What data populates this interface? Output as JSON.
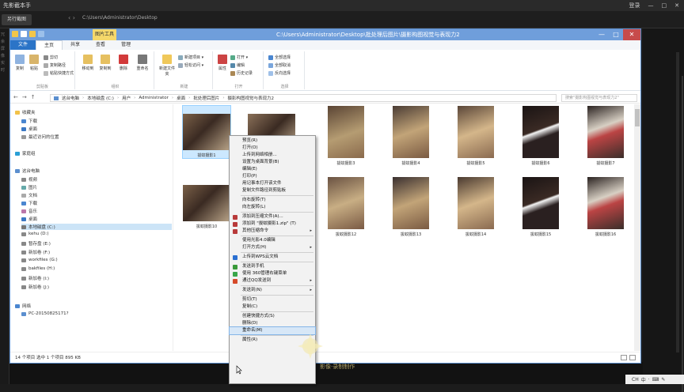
{
  "app": {
    "title": "先影截本手",
    "toolbar_button": "另行截图",
    "path": "C:\\Users\\Administrator\\Desktop",
    "controls": [
      "登录",
      "—",
      "□",
      "✕"
    ],
    "left_rail": [
      "冗",
      "余",
      "屏",
      "像",
      "实",
      "时"
    ]
  },
  "window": {
    "title": "C:\\Users\\Administrator\\Desktop\\批处理后图片\\摄影构图视觉与表现力2",
    "tool_tab": "图片工具",
    "controls": [
      "—",
      "□",
      "✕"
    ]
  },
  "ribbon": {
    "tabs": [
      "文件",
      "主页",
      "共享",
      "查看",
      "管理"
    ],
    "groups": [
      {
        "label": "剪贴板",
        "buttons": [
          "复制",
          "粘贴"
        ],
        "small": [
          "剪切",
          "复制路径",
          "粘贴快捷方式"
        ]
      },
      {
        "label": "组织",
        "buttons": [
          "移动到",
          "复制到",
          "删除",
          "重命名"
        ]
      },
      {
        "label": "新建",
        "buttons": [
          "新建文件夹"
        ],
        "small": [
          "新建项目 ▾",
          "轻松访问 ▾"
        ]
      },
      {
        "label": "打开",
        "buttons": [
          "属性"
        ],
        "small": [
          "打开 ▾",
          "编辑",
          "历史记录"
        ]
      },
      {
        "label": "选择",
        "small": [
          "全部选择",
          "全部取消",
          "反向选择"
        ]
      }
    ]
  },
  "address": {
    "crumbs": [
      "这台电脑",
      "本地磁盘 (C:)",
      "用户",
      "Administrator",
      "桌面",
      "批处理后图片",
      "摄影构图视觉与表现力2"
    ],
    "search_placeholder": "搜索\"摄影构图视觉与表现力2\""
  },
  "nav_pane": {
    "favorites": "收藏夹",
    "fav_items": [
      "下载",
      "桌面",
      "最近访问的位置"
    ],
    "homegroup": "家庭组",
    "thispc": "这台电脑",
    "pc_items": [
      "视频",
      "图片",
      "文档",
      "下载",
      "音乐",
      "桌面",
      "本地磁盘 (C:)",
      "kehu (D:)",
      "暂存盘 (E:)",
      "新加卷 (F:)",
      "workfiles (G:)",
      "bakfiles (H:)",
      "新加卷 (I:)",
      "新加卷 (J:)"
    ],
    "network": "网络",
    "network_items": [
      "PC-20150825171?"
    ]
  },
  "files": [
    "拔蚊摄影1",
    "",
    "拔蚊摄影3",
    "拔蚊摄影4",
    "拔蚊摄影5",
    "拔蚊摄影6",
    "拔蚊摄影7",
    "拔蚊摄影10",
    "",
    "拔蚊摄影12",
    "拔蚊摄影13",
    "拔蚊摄影14",
    "拔蚊摄影15",
    "拔蚊摄影16"
  ],
  "status": {
    "text": "14 个项目    选中 1 个项目  895 KB"
  },
  "context_menu": {
    "items": [
      {
        "label": "预览(R)",
        "icon": "",
        "arrow": false
      },
      {
        "label": "打开(O)",
        "icon": "",
        "arrow": false
      },
      {
        "label": "上传到网络相册...",
        "icon": "",
        "arrow": false
      },
      {
        "label": "设置为桌面背景(B)",
        "icon": "",
        "arrow": false
      },
      {
        "label": "编辑(E)",
        "icon": "",
        "arrow": false
      },
      {
        "label": "打印(P)",
        "icon": "",
        "arrow": false
      },
      {
        "label": "用记事本打开该文件",
        "icon": "",
        "arrow": false
      },
      {
        "label": "复制文件路径到剪贴板",
        "icon": "",
        "arrow": false
      },
      {
        "sep": true
      },
      {
        "label": "向右旋转(T)",
        "icon": "",
        "arrow": false
      },
      {
        "label": "向左旋转(L)",
        "icon": "",
        "arrow": false
      },
      {
        "sep": true
      },
      {
        "label": "添加到压缩文件(A)...",
        "icon": "archive",
        "arrow": false
      },
      {
        "label": "添加到 \"拔蚊摄影1.zip\" (T)",
        "icon": "archive",
        "arrow": false
      },
      {
        "label": "其他压缩命令",
        "icon": "archive",
        "arrow": true
      },
      {
        "sep": true
      },
      {
        "label": "使用光影4.0编辑",
        "icon": "",
        "arrow": false
      },
      {
        "label": "打开方式(H)",
        "icon": "",
        "arrow": true
      },
      {
        "sep": true
      },
      {
        "label": "上传到WPS云文档",
        "icon": "wps",
        "arrow": false
      },
      {
        "sep": true
      },
      {
        "label": "发送到手机",
        "icon": "phone",
        "arrow": false
      },
      {
        "label": "使用 360管理右键菜单",
        "icon": "360",
        "arrow": false
      },
      {
        "label": "通过QQ发送到",
        "icon": "qq",
        "arrow": true
      },
      {
        "sep": true
      },
      {
        "label": "发送到(N)",
        "icon": "",
        "arrow": true
      },
      {
        "sep": true
      },
      {
        "label": "剪切(T)",
        "icon": "",
        "arrow": false
      },
      {
        "label": "复制(C)",
        "icon": "",
        "arrow": false
      },
      {
        "sep": true
      },
      {
        "label": "创建快捷方式(S)",
        "icon": "",
        "arrow": false
      },
      {
        "label": "删除(D)",
        "icon": "",
        "arrow": false
      },
      {
        "label": "重命名(M)",
        "icon": "",
        "arrow": false,
        "highlight": true
      },
      {
        "sep": true
      },
      {
        "label": "属性(R)",
        "icon": "",
        "arrow": false
      }
    ]
  },
  "watermark": "影像·录制制作",
  "taskbar": [
    "CH",
    "中",
    "·",
    "⌨",
    "✎"
  ],
  "colors": {
    "accent": "#2b74c7",
    "title_bar": "#6f9edb",
    "tool_tab": "#f5d86a",
    "selection": "#cce8ff",
    "menu_highlight": "#d7e7f7"
  }
}
